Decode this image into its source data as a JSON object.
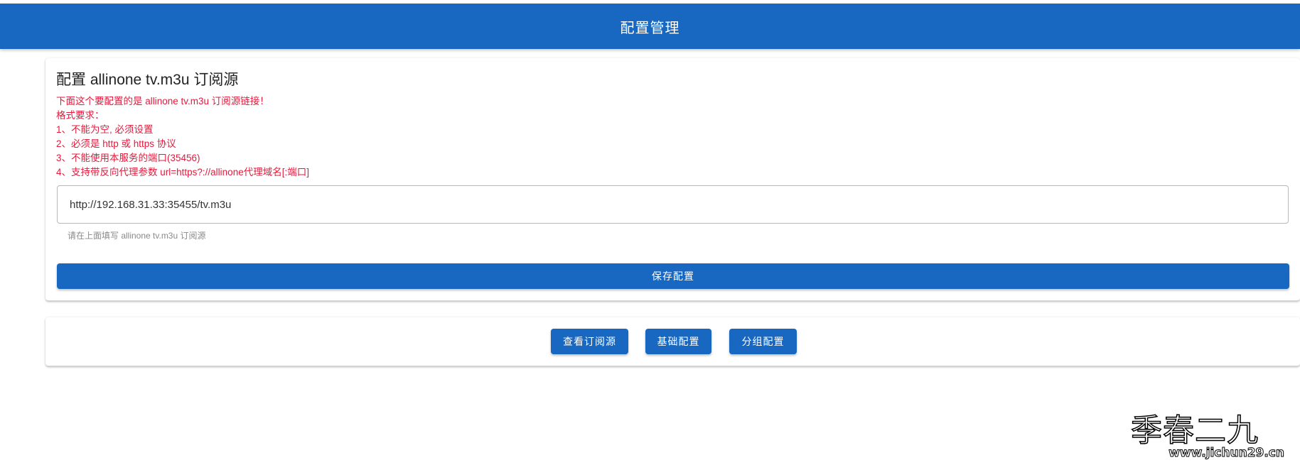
{
  "header": {
    "title": "配置管理"
  },
  "config_card": {
    "title": "配置 allinone tv.m3u 订阅源",
    "notes": [
      "下面这个要配置的是 allinone tv.m3u 订阅源链接！",
      "格式要求：",
      "1、不能为空, 必须设置",
      "2、必须是 http 或 https 协议",
      "3、不能使用本服务的端口(35456)",
      "4、支持带反向代理参数 url=https?://allinone代理域名[:端口]"
    ],
    "input_value": "http://192.168.31.33:35455/tv.m3u",
    "input_hint": "请在上面填写 allinone tv.m3u 订阅源",
    "save_label": "保存配置"
  },
  "nav": {
    "buttons": [
      "查看订阅源",
      "基础配置",
      "分组配置"
    ]
  },
  "watermark": {
    "name": "季春二九",
    "url": "www.jichun29.cn"
  },
  "colors": {
    "primary": "#1867c0",
    "note_red": "#e21b3c"
  }
}
